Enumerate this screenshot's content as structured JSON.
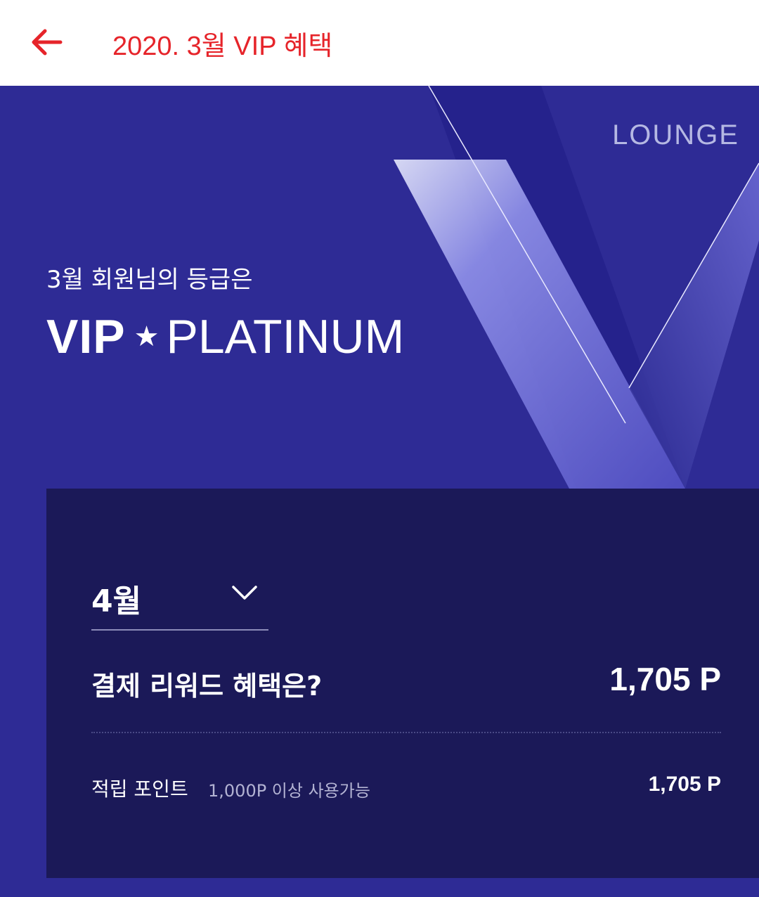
{
  "header": {
    "title": "2020. 3월 VIP 혜택",
    "back_icon": "back-arrow-icon",
    "accent_color": "#e6242a"
  },
  "hero": {
    "brand": "LOUNGE",
    "grade_intro": "3월 회원님의 등급은",
    "grade_prefix": "VIP",
    "grade_star": "★",
    "grade_tier": "PLATINUM",
    "background_color": "#2e2b95"
  },
  "card": {
    "month_selected": "4월",
    "dropdown_icon": "chevron-down-icon",
    "reward_title": "결제 리워드 혜택은?",
    "reward_value": "1,705 P",
    "points_label": "적립 포인트",
    "points_note": "1,000P 이상 사용가능",
    "points_value": "1,705 P",
    "background_color": "#1b1958"
  }
}
